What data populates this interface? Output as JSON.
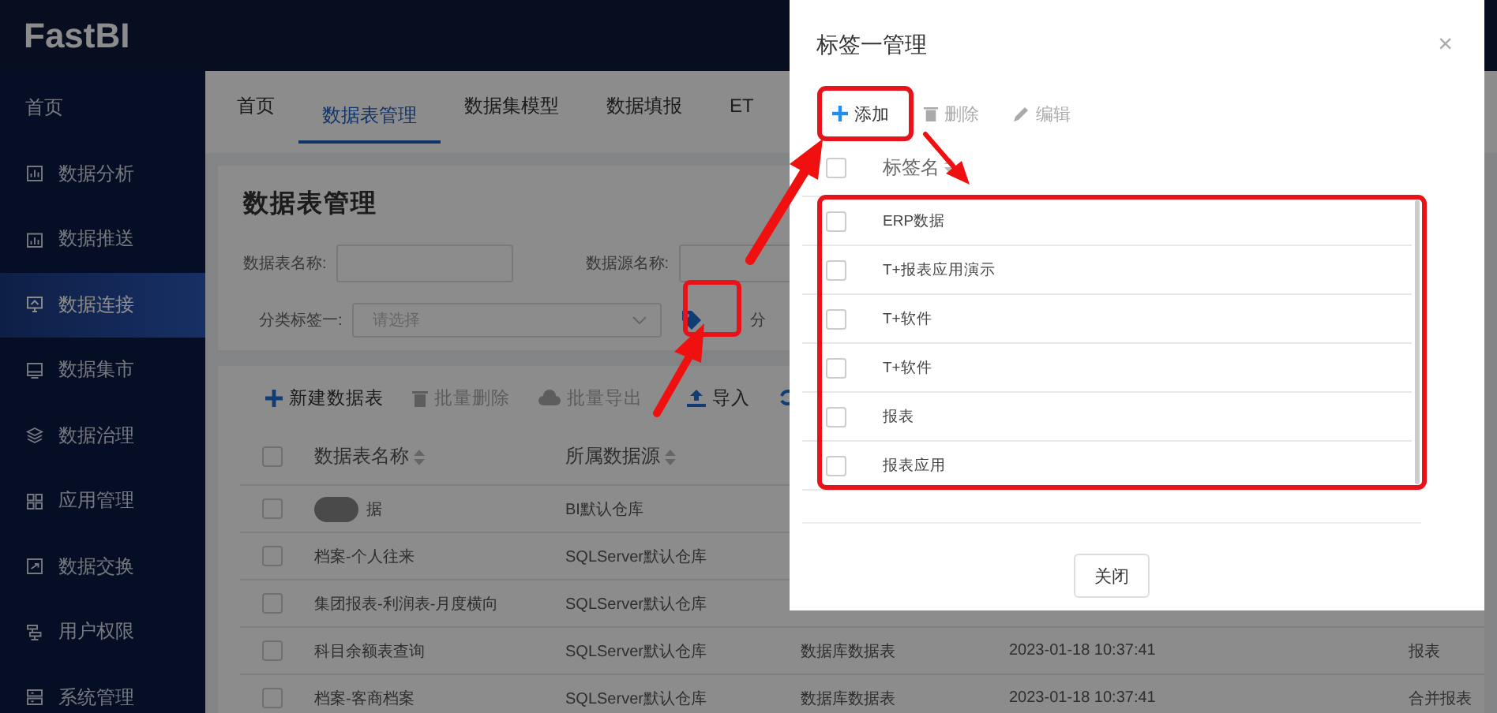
{
  "logo": "FastBI",
  "sidebar": [
    {
      "label": "首页",
      "selected": false
    },
    {
      "label": "数据分析",
      "selected": false
    },
    {
      "label": "数据推送",
      "selected": false
    },
    {
      "label": "数据连接",
      "selected": true
    },
    {
      "label": "数据集市",
      "selected": false
    },
    {
      "label": "数据治理",
      "selected": false
    },
    {
      "label": "应用管理",
      "selected": false
    },
    {
      "label": "数据交换",
      "selected": false
    },
    {
      "label": "用户权限",
      "selected": false
    },
    {
      "label": "系统管理",
      "selected": false
    }
  ],
  "tabs": [
    {
      "label": "首页",
      "selected": false
    },
    {
      "label": "数据表管理",
      "selected": true
    },
    {
      "label": "数据集模型",
      "selected": false
    },
    {
      "label": "数据填报",
      "selected": false
    },
    {
      "label": "ET",
      "selected": false
    }
  ],
  "page_title": "数据表管理",
  "filters_row_1": [
    {
      "label": "数据表名称:",
      "kind": "input"
    },
    {
      "label": "数据源名称:",
      "kind": "input"
    }
  ],
  "filters_row_2": [
    {
      "label": "分类标签一:",
      "kind": "select",
      "placeholder": "请选择"
    },
    {
      "label": "分",
      "kind": "label"
    }
  ],
  "toolbar": [
    {
      "label": "新建数据表",
      "disabled": false
    },
    {
      "label": "批量删除",
      "disabled": true
    },
    {
      "label": "批量导出",
      "disabled": true
    },
    {
      "label": "导入",
      "disabled": false
    }
  ],
  "table": {
    "header_checked": false,
    "columns": [
      "数据表名称",
      "所属数据源"
    ],
    "rows": [
      {
        "checked": false,
        "name": "据",
        "redacted": true,
        "source": "BI默认仓库"
      },
      {
        "checked": false,
        "name": "档案-个人往来",
        "redacted": false,
        "source": "SQLServer默认仓库"
      },
      {
        "checked": false,
        "name": "集团报表-利润表-月度横向",
        "redacted": false,
        "source": "SQLServer默认仓库"
      },
      {
        "checked": false,
        "name": "科目余额表查询",
        "redacted": false,
        "source": "SQLServer默认仓库",
        "column_3": "数据库数据表",
        "column_4": "2023-01-18 10:37:41",
        "column_5": "报表"
      },
      {
        "checked": false,
        "name": "档案-客商档案",
        "redacted": false,
        "source": "SQLServer默认仓库",
        "column_3": "数据库数据表",
        "column_4": "2023-01-18 10:37:41",
        "column_5": "合并报表"
      }
    ]
  },
  "dialog": {
    "title": "标签一管理",
    "close": "×",
    "toolbar": [
      {
        "label": "添加",
        "disabled": false
      },
      {
        "label": "删除",
        "disabled": true
      },
      {
        "label": "编辑",
        "disabled": true
      }
    ],
    "header_checked": false,
    "column": "标签名",
    "rows": [
      {
        "label": "ERP数据",
        "checked": false
      },
      {
        "label": "T+报表应用演示",
        "checked": false
      },
      {
        "label": "T+软件",
        "checked": false
      },
      {
        "label": "T+软件",
        "checked": false
      },
      {
        "label": "报表",
        "checked": false
      },
      {
        "label": "报表应用",
        "checked": false
      }
    ],
    "footer_button": "关闭"
  }
}
